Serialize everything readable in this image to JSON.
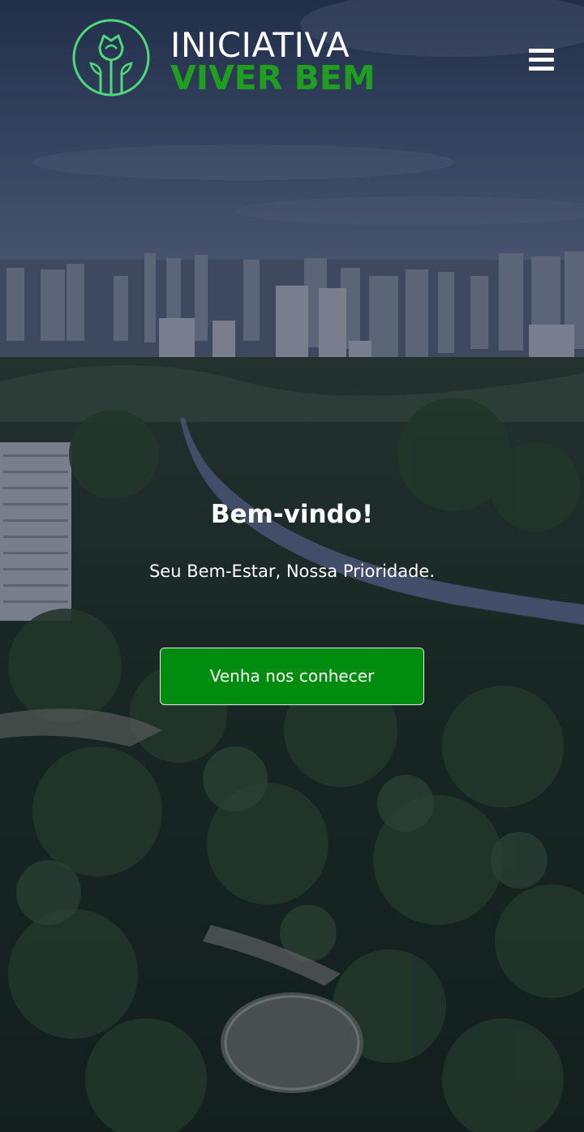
{
  "brand": {
    "line1": "INICIATIVA",
    "line2": "VIVER BEM",
    "logo_icon": "rose-seedling-icon",
    "primary_color": "#1f9e1f",
    "logo_ring_color": "#4fd77b"
  },
  "header": {
    "menu_icon": "hamburger-menu-icon"
  },
  "hero": {
    "background": "aerial-city-park-river-photo",
    "title": "Bem-vindo!",
    "subtitle": "Seu Bem-Estar, Nossa Prioridade.",
    "cta_label": "Venha nos conhecer",
    "cta_color": "#008c0e"
  }
}
